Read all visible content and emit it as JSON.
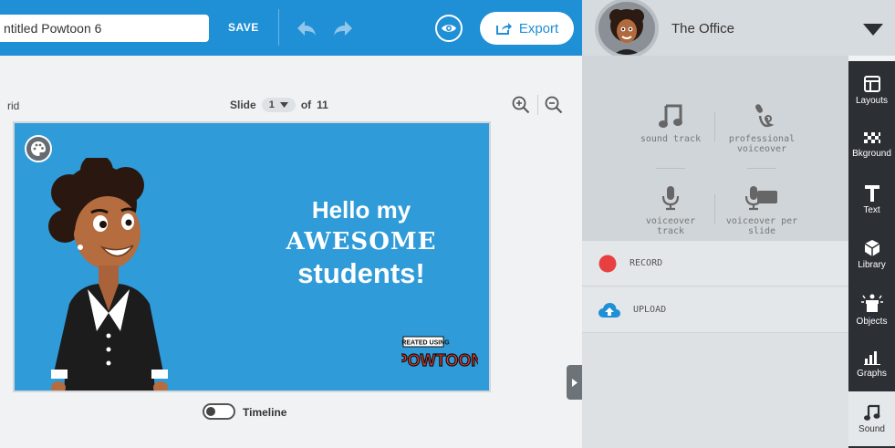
{
  "header": {
    "project_title": "ntitled Powtoon 6",
    "save_label": "SAVE",
    "export_label": "Export"
  },
  "style": {
    "name": "The Office"
  },
  "canvas": {
    "grid_label": "rid",
    "slide_label": "Slide",
    "slide_current": "1",
    "slide_of": "of",
    "slide_total": "11",
    "timeline_label": "Timeline"
  },
  "slide": {
    "line1": "Hello my",
    "line2": "AWESOME",
    "line3": "students!",
    "watermark_small": "CREATED USING",
    "watermark_brand": "POWTOON",
    "bg_color": "#2f9bd9"
  },
  "sound_panel": {
    "options": [
      {
        "label": "sound track",
        "icon": "music-note-icon"
      },
      {
        "label": "professional voiceover",
        "icon": "voiceover-icon"
      },
      {
        "label": "voiceover track",
        "icon": "microphone-icon"
      },
      {
        "label": "voiceover per slide",
        "icon": "mic-slide-icon"
      }
    ],
    "record_label": "RECORD",
    "upload_label": "UPLOAD"
  },
  "rail": {
    "items": [
      {
        "label": "Layouts",
        "icon": "layouts-icon"
      },
      {
        "label": "Bkground",
        "icon": "background-icon"
      },
      {
        "label": "Text",
        "icon": "text-icon"
      },
      {
        "label": "Library",
        "icon": "library-icon"
      },
      {
        "label": "Objects",
        "icon": "objects-icon"
      },
      {
        "label": "Graphs",
        "icon": "graphs-icon"
      },
      {
        "label": "Sound",
        "icon": "music-note-icon"
      }
    ]
  },
  "colors": {
    "topbar": "#1f8fd6",
    "record_red": "#e84040",
    "rail_bg": "#2c3035"
  }
}
